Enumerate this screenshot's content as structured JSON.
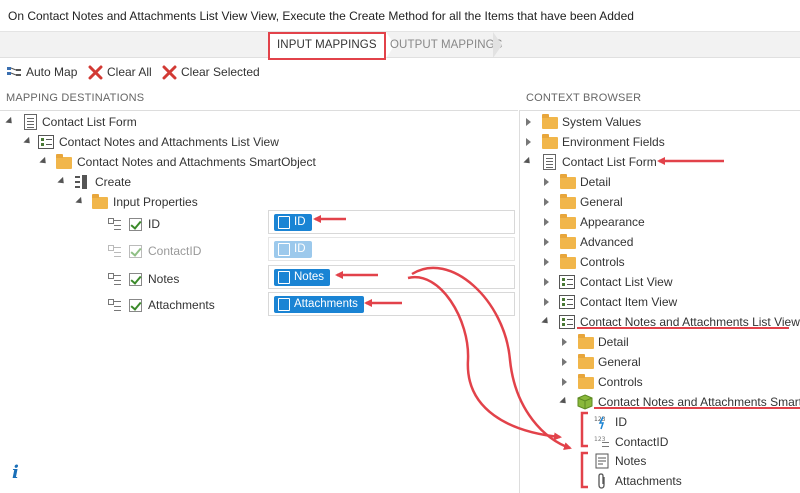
{
  "title": "On Contact Notes and Attachments List View View, Execute the Create Method for all the Items that have been Added",
  "wizard": {
    "input_label": "INPUT MAPPINGS",
    "output_label": "OUTPUT MAPPINGS",
    "active": "INPUT MAPPINGS"
  },
  "toolbar": {
    "auto_map": "Auto Map",
    "clear_all": "Clear All",
    "clear_selected": "Clear Selected"
  },
  "mapping_destinations": {
    "header": "MAPPING DESTINATIONS",
    "tree": {
      "form": "Contact List Form",
      "view": "Contact Notes and Attachments List View",
      "smartobject": "Contact Notes and Attachments SmartObject",
      "method": "Create",
      "input_properties": "Input Properties",
      "properties": [
        {
          "label": "ID",
          "checked": true,
          "enabled": true,
          "mapped": "ID",
          "mapped_icon": "autonumber-icon",
          "mapped_enabled": true
        },
        {
          "label": "ContactID",
          "checked": true,
          "enabled": false,
          "mapped": "ID",
          "mapped_icon": "autonumber-icon",
          "mapped_enabled": false
        },
        {
          "label": "Notes",
          "checked": true,
          "enabled": true,
          "mapped": "Notes",
          "mapped_icon": "memo-icon",
          "mapped_enabled": true
        },
        {
          "label": "Attachments",
          "checked": true,
          "enabled": true,
          "mapped": "Attachments",
          "mapped_icon": "paperclip-icon",
          "mapped_enabled": true
        }
      ]
    }
  },
  "context_browser": {
    "header": "CONTEXT BROWSER",
    "items": {
      "system_values": "System Values",
      "environment_fields": "Environment Fields",
      "contact_list_form": "Contact List Form",
      "detail": "Detail",
      "general": "General",
      "appearance": "Appearance",
      "advanced": "Advanced",
      "controls": "Controls",
      "contact_list_view": "Contact List View",
      "contact_item_view": "Contact Item View",
      "notes_list_view": "Contact Notes and Attachments List View",
      "sub_detail": "Detail",
      "sub_general": "General",
      "sub_controls": "Controls",
      "smartobject": "Contact Notes and Attachments SmartObject",
      "prop_id": "ID",
      "prop_contactid": "ContactID",
      "prop_notes": "Notes",
      "prop_attachments": "Attachments"
    }
  },
  "info_icon": "i",
  "colors": {
    "accent_blue": "#1a84d4",
    "annotation_red": "#e2424a",
    "folder": "#f1b64b"
  }
}
